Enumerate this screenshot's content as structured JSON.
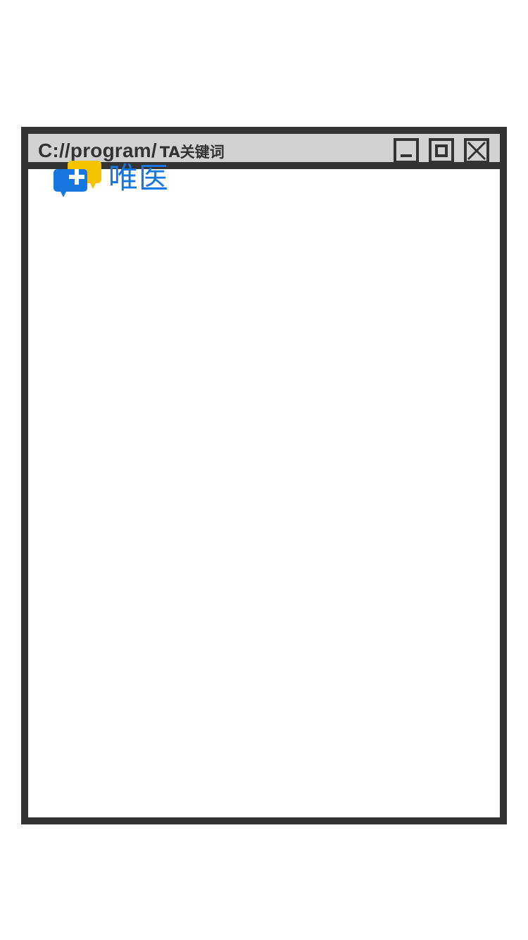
{
  "window": {
    "title_path": "C://program/",
    "title_keyword": "TA关键词"
  },
  "controls": {
    "minimize_icon": "minimize-icon",
    "maximize_icon": "maximize-icon",
    "close_icon": "close-icon"
  },
  "logo": {
    "icon": "medical-chat-bubbles-icon",
    "text": "唯医",
    "colors": {
      "blue": "#1677e0",
      "yellow": "#f7c300"
    }
  },
  "colors": {
    "frame": "#333333",
    "titlebar": "#d2d2d2",
    "background": "#ffffff"
  }
}
